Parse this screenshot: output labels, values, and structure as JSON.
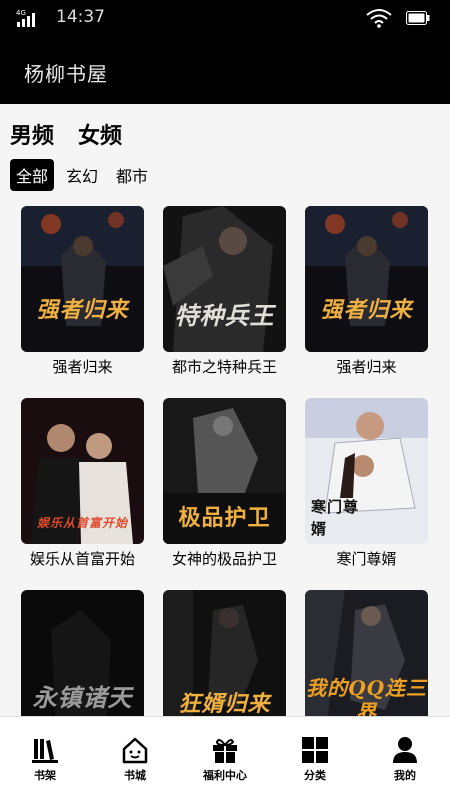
{
  "status_bar": {
    "network": "4G",
    "time": "14:37"
  },
  "header": {
    "title": "杨柳书屋"
  },
  "gender_tabs": [
    "男频",
    "女频"
  ],
  "genre_tabs": [
    "全部",
    "玄幻",
    "都市"
  ],
  "books": [
    {
      "title": "强者归来",
      "cover_text": "强者归来",
      "accent": "#c8461c"
    },
    {
      "title": "都市之特种兵王",
      "cover_text": "特种兵王",
      "accent": "#d8a840"
    },
    {
      "title": "强者归来",
      "cover_text": "强者归来",
      "accent": "#c8461c"
    },
    {
      "title": "娱乐从首富开始",
      "cover_text": "娱乐从首富开始",
      "accent": "#e04a2c"
    },
    {
      "title": "女神的极品护卫",
      "cover_text": "极品护卫",
      "accent": "#e8a030"
    },
    {
      "title": "寒门尊婿",
      "cover_text": "寒门尊婿",
      "accent": "#2a3a8a"
    },
    {
      "title": "",
      "cover_text": "永镇诸天",
      "accent": "#9a9a9a"
    },
    {
      "title": "",
      "cover_text": "狂婿归来",
      "accent": "#e8a030"
    },
    {
      "title": "",
      "cover_text": "我的QQ连三界",
      "accent": "#f0a020"
    }
  ],
  "nav": [
    {
      "label": "书架",
      "icon": "bookshelf-icon"
    },
    {
      "label": "书城",
      "icon": "store-icon"
    },
    {
      "label": "福利中心",
      "icon": "gift-icon"
    },
    {
      "label": "分类",
      "icon": "category-icon"
    },
    {
      "label": "我的",
      "icon": "user-icon"
    }
  ]
}
